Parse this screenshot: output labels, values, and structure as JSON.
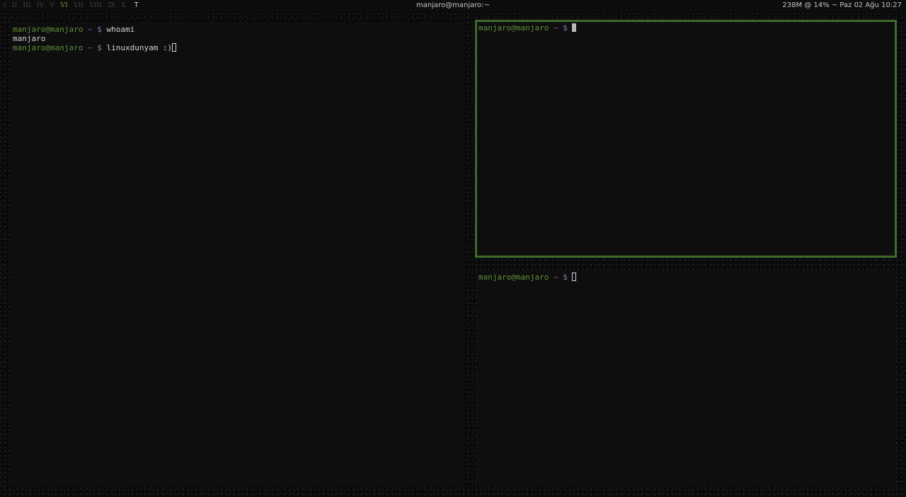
{
  "topbar": {
    "workspaces": [
      "I",
      "II",
      "III",
      "IV",
      "V",
      "VI",
      "VII",
      "VIII",
      "IX",
      "X"
    ],
    "active_workspace": "VI",
    "layout_symbol": "T",
    "window_title": "manjaro@manjaro:~",
    "status": "238M @ 14% ~ Paz 02 Ağu 10:27"
  },
  "panes": {
    "left": {
      "lines": [
        {
          "prompt_user": "manjaro@manjaro",
          "prompt_path": "~",
          "prompt_symbol": "$",
          "command": "whoami"
        },
        {
          "output": "manjaro"
        },
        {
          "prompt_user": "manjaro@manjaro",
          "prompt_path": "~",
          "prompt_symbol": "$",
          "command": "linuxdunyam :)"
        }
      ]
    },
    "top_right": {
      "focused": true,
      "lines": [
        {
          "prompt_user": "manjaro@manjaro",
          "prompt_path": "~",
          "prompt_symbol": "$",
          "command": ""
        }
      ]
    },
    "bottom_right": {
      "lines": [
        {
          "prompt_user": "manjaro@manjaro",
          "prompt_path": "~",
          "prompt_symbol": "$",
          "command": ""
        }
      ]
    }
  },
  "colors": {
    "focus_border": "#3f6a2c",
    "prompt_user": "#5f8f3a",
    "active_workspace": "#6d9a3c",
    "pane_bg": "#0e0e0e"
  }
}
